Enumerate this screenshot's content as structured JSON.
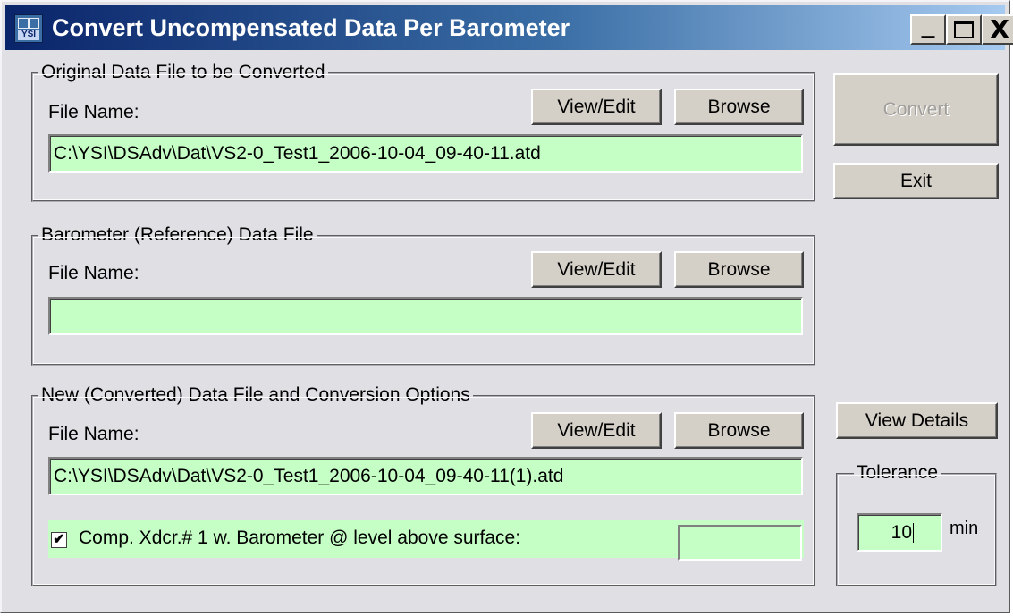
{
  "window": {
    "title": "Convert Uncompensated Data Per Barometer",
    "icon_text": "YSI",
    "controls": {
      "minimize": "_",
      "maximize": "□",
      "close": "X"
    }
  },
  "original_group": {
    "legend": "Original Data File to be Converted",
    "file_label": "File Name:",
    "view_edit": "View/Edit",
    "browse": "Browse",
    "file_value": "C:\\YSI\\DSAdv\\Dat\\VS2-0_Test1_2006-10-04_09-40-11.atd"
  },
  "barometer_group": {
    "legend": "Barometer (Reference) Data File",
    "file_label": "File Name:",
    "view_edit": "View/Edit",
    "browse": "Browse",
    "file_value": ""
  },
  "new_group": {
    "legend": "New (Converted) Data File and Conversion Options",
    "file_label": "File Name:",
    "view_edit": "View/Edit",
    "browse": "Browse",
    "file_value": "C:\\YSI\\DSAdv\\Dat\\VS2-0_Test1_2006-10-04_09-40-11(1).atd",
    "checkbox_checked": true,
    "checkbox_mark": "✔",
    "checkbox_label": "Comp. Xdcr.# 1 w. Barometer @ level above surface:",
    "level_value": ""
  },
  "side": {
    "convert": "Convert",
    "exit": "Exit",
    "view_details": "View Details"
  },
  "tolerance": {
    "legend": "Tolerance",
    "value": "10",
    "unit": "min"
  },
  "colors": {
    "field_bg": "#c5ffc5",
    "title_start": "#0a246a",
    "title_end": "#a6caf0"
  }
}
